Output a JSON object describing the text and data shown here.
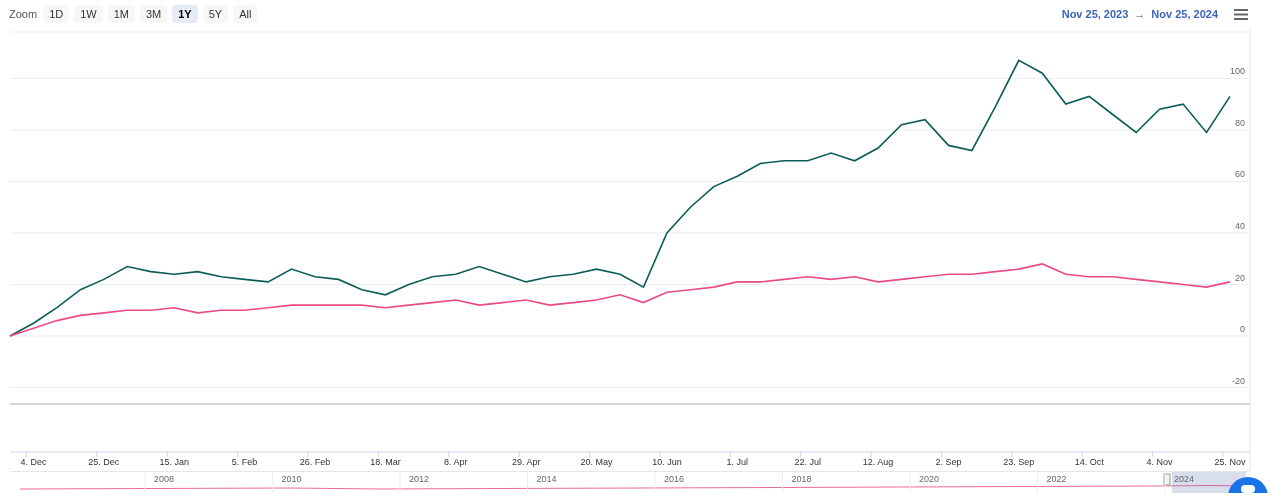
{
  "toolbar": {
    "zoom_label": "Zoom",
    "ranges": [
      {
        "label": "1D",
        "selected": false
      },
      {
        "label": "1W",
        "selected": false
      },
      {
        "label": "1M",
        "selected": false
      },
      {
        "label": "3M",
        "selected": false
      },
      {
        "label": "1Y",
        "selected": true
      },
      {
        "label": "5Y",
        "selected": false
      },
      {
        "label": "All",
        "selected": false
      }
    ],
    "date_from": "Nov 25, 2023",
    "arrow": "→",
    "date_to": "Nov 25, 2024"
  },
  "chart_data": {
    "type": "line",
    "grid": true,
    "ylim": [
      -45,
      118
    ],
    "categories": [
      null,
      "4. Dec",
      null,
      null,
      "25. Dec",
      null,
      null,
      "15. Jan",
      null,
      null,
      "5. Feb",
      null,
      null,
      "26. Feb",
      null,
      null,
      "18. Mar",
      null,
      null,
      "8. Apr",
      null,
      null,
      "29. Apr",
      null,
      null,
      "20. May",
      null,
      null,
      "10. Jun",
      null,
      null,
      "1. Jul",
      null,
      null,
      "22. Jul",
      null,
      null,
      "12. Aug",
      null,
      null,
      "2. Sep",
      null,
      null,
      "23. Sep",
      null,
      null,
      "14. Oct",
      null,
      null,
      "4. Nov",
      null,
      null,
      "25. Nov"
    ],
    "yticks": [
      -20,
      0,
      20,
      40,
      60,
      80,
      100
    ],
    "series": [
      {
        "color": "#0b5e57",
        "values": [
          0,
          5,
          11,
          18,
          22,
          27,
          25,
          24,
          25,
          23,
          22,
          21,
          26,
          23,
          22,
          18,
          16,
          20,
          23,
          24,
          27,
          24,
          21,
          23,
          24,
          26,
          24,
          19,
          40,
          50,
          58,
          62,
          67,
          68,
          68,
          71,
          68,
          73,
          82,
          84,
          74,
          72,
          89,
          107,
          102,
          90,
          93,
          86,
          79,
          88,
          90,
          79,
          93
        ]
      },
      {
        "color": "#ec4a86",
        "values": [
          0,
          3,
          6,
          8,
          9,
          10,
          10,
          11,
          9,
          10,
          10,
          11,
          12,
          12,
          12,
          12,
          11,
          12,
          13,
          14,
          12,
          13,
          14,
          12,
          13,
          14,
          16,
          13,
          17,
          18,
          19,
          21,
          21,
          22,
          23,
          22,
          23,
          21,
          22,
          23,
          24,
          24,
          25,
          26,
          28,
          24,
          23,
          23,
          22,
          21,
          20,
          19,
          21
        ]
      }
    ]
  },
  "navigator": {
    "years": [
      "2008",
      "2010",
      "2012",
      "2014",
      "2016",
      "2018",
      "2020",
      "2022",
      "2024"
    ]
  }
}
